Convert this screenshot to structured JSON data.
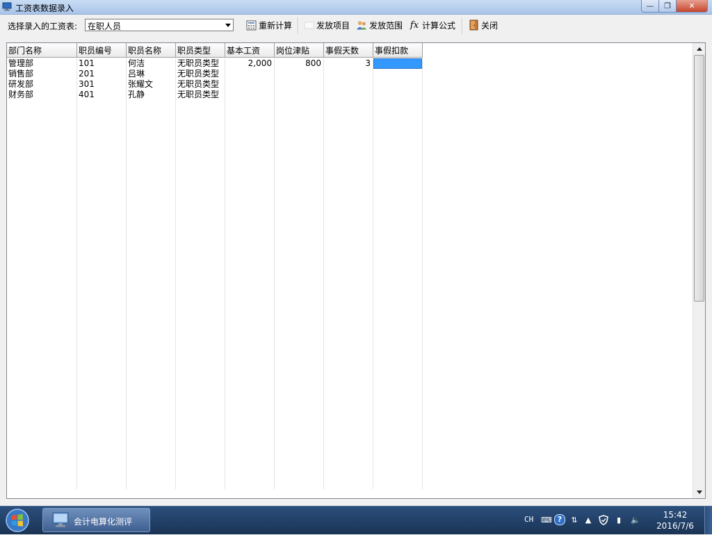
{
  "window": {
    "title": "工资表数据录入"
  },
  "toolbar": {
    "select_label": "选择录入的工资表:",
    "select_value": "在职人员",
    "recalc": "重新计算",
    "items": "发放项目",
    "scope": "发放范围",
    "formula": "计算公式",
    "close": "关闭"
  },
  "grid": {
    "columns": [
      "部门名称",
      "职员编号",
      "职员名称",
      "职员类型",
      "基本工资",
      "岗位津贴",
      "事假天数",
      "事假扣款"
    ],
    "rows": [
      [
        "管理部",
        "101",
        "何洁",
        "无职员类型",
        "2,000",
        "800",
        "3",
        ""
      ],
      [
        "销售部",
        "201",
        "吕琳",
        "无职员类型",
        "",
        "",
        "",
        ""
      ],
      [
        "研发部",
        "301",
        "张耀文",
        "无职员类型",
        "",
        "",
        "",
        ""
      ],
      [
        "财务部",
        "401",
        "孔静",
        "无职员类型",
        "",
        "",
        "",
        ""
      ]
    ]
  },
  "taskbar": {
    "app_label": "会计电算化测评",
    "lang": "CH",
    "time": "15:42",
    "date": "2016/7/6"
  },
  "colors": {
    "selection": "#3399ff",
    "taskbar": "#1f3d63"
  }
}
